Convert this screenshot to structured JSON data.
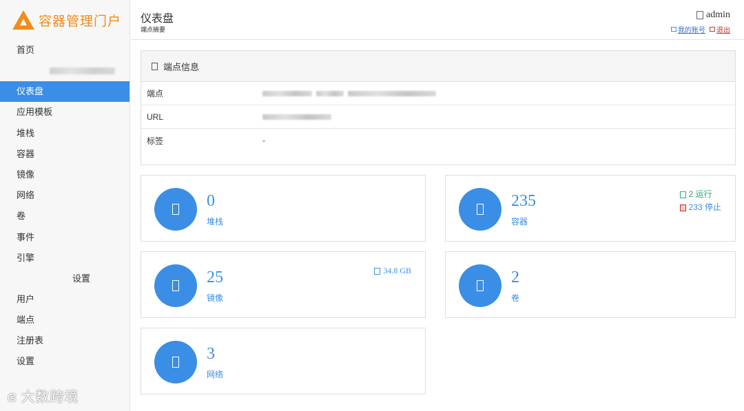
{
  "app": {
    "name": "容器管理门户"
  },
  "sidebar": {
    "items": [
      {
        "label": "首页"
      },
      {
        "label": "仪表盘"
      },
      {
        "label": "应用模板"
      },
      {
        "label": "堆栈"
      },
      {
        "label": "容器"
      },
      {
        "label": "镜像"
      },
      {
        "label": "网络"
      },
      {
        "label": "卷"
      },
      {
        "label": "事件"
      },
      {
        "label": "引擎"
      }
    ],
    "section_label": "设置",
    "settings_items": [
      {
        "label": "用户"
      },
      {
        "label": "端点"
      },
      {
        "label": "注册表"
      },
      {
        "label": "设置"
      }
    ],
    "watermark": "大数跨境"
  },
  "header": {
    "title": "仪表盘",
    "subtitle": "端点摘要",
    "user": "admin",
    "my_account": "我的账号",
    "logout": "退出"
  },
  "endpoint_info": {
    "title": "端点信息",
    "rows": [
      {
        "label": "端点",
        "value": "-"
      },
      {
        "label": "URL",
        "value": "-"
      },
      {
        "label": "标签",
        "value": "-"
      }
    ]
  },
  "widgets": {
    "stacks": {
      "value": "0",
      "label": "堆栈"
    },
    "containers": {
      "value": "235",
      "label": "容器",
      "running": "2 运行",
      "stopped": "233 停止"
    },
    "images": {
      "value": "25",
      "label": "镜像",
      "size": "34.8 GB"
    },
    "volumes": {
      "value": "2",
      "label": "卷"
    },
    "networks": {
      "value": "3",
      "label": "网络"
    }
  },
  "colors": {
    "accent": "#3a8ee6",
    "brand": "#f08c1a",
    "running": "#2aa876",
    "stopped": "#c0392b"
  }
}
